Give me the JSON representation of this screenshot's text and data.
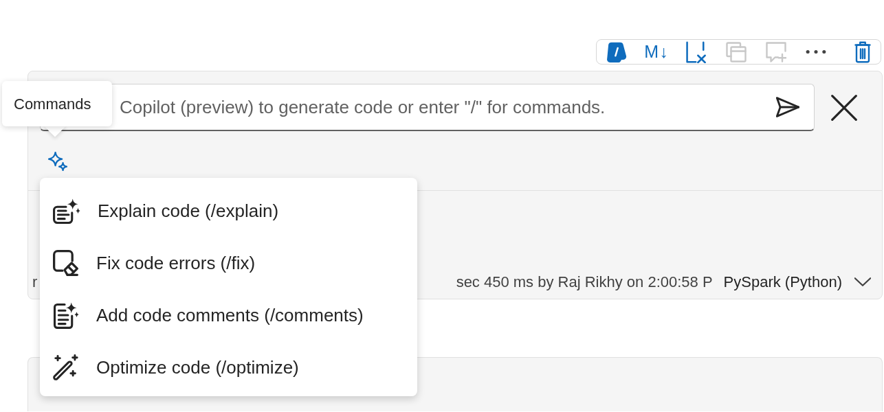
{
  "toolbar": {
    "buttons": [
      {
        "kind": "copilot",
        "disabled": false
      },
      {
        "kind": "markdown",
        "label": "M↓",
        "disabled": false
      },
      {
        "kind": "clear-output",
        "disabled": false
      },
      {
        "kind": "stack",
        "disabled": true
      },
      {
        "kind": "comment",
        "disabled": true
      },
      {
        "kind": "more",
        "disabled": false
      },
      {
        "kind": "delete",
        "disabled": false
      }
    ]
  },
  "prompt": {
    "placeholder": "Copilot (preview) to generate code or enter \"/\" for commands."
  },
  "tooltip": {
    "text": "Commands"
  },
  "commands_menu": {
    "items": [
      {
        "kind": "explain",
        "label": "Explain code (/explain)"
      },
      {
        "kind": "fix",
        "label": "Fix code errors (/fix)"
      },
      {
        "kind": "comments",
        "label": "Add code comments (/comments)"
      },
      {
        "kind": "optimize",
        "label": "Optimize code (/optimize)"
      }
    ]
  },
  "status": {
    "left_fragment": "r",
    "run_info": "sec 450 ms by Raj Rikhy on 2:00:58 P",
    "language": "PySpark (Python)"
  }
}
